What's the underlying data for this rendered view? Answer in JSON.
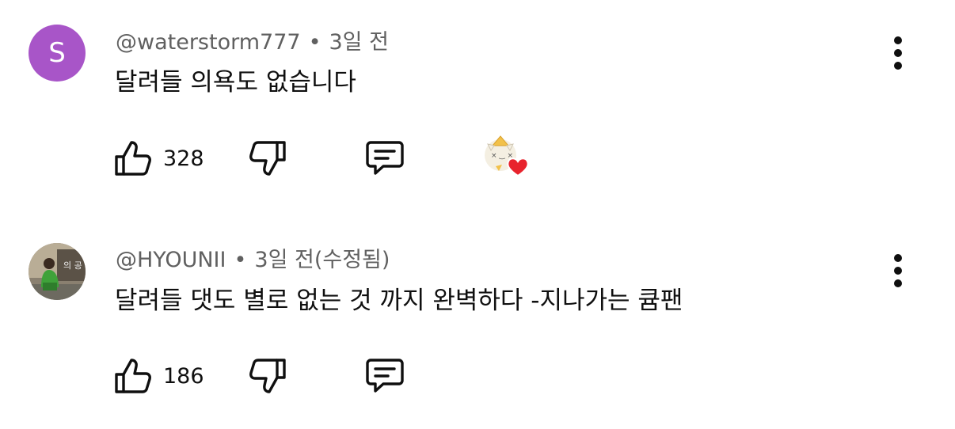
{
  "comments": [
    {
      "avatar_letter": "S",
      "avatar_color": "#a855c8",
      "handle": "@waterstorm777",
      "separator": "•",
      "time": "3일 전",
      "text": "달려들 의욕도 없습니다",
      "likes": "328",
      "creator_heart": true
    },
    {
      "handle": "@HYOUNII",
      "separator": "•",
      "time": "3일 전(수정됨)",
      "text": "달려들 댓도 별로 없는 것 까지 완벽하다 -지나가는 큠팬",
      "likes": "186",
      "creator_heart": false
    }
  ],
  "icons": {
    "like": "thumbs-up-icon",
    "dislike": "thumbs-down-icon",
    "reply": "reply-comment-icon",
    "more": "more-vertical-icon",
    "heart": "creator-heart-icon"
  },
  "colors": {
    "text": "#0f0f0f",
    "secondary": "#606060",
    "heart": "#e8232d"
  }
}
